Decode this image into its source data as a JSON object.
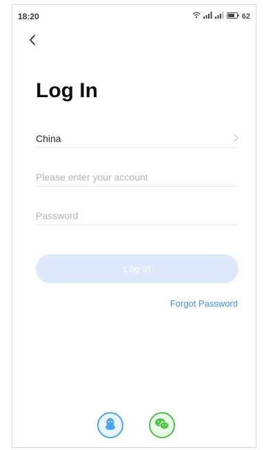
{
  "status_bar": {
    "time": "18:20",
    "battery": "62"
  },
  "page": {
    "title": "Log In"
  },
  "form": {
    "region_value": "China",
    "account_placeholder": "Please enter your account",
    "password_placeholder": "Password",
    "login_label": "Log In",
    "forgot_label": "Forgot Password"
  },
  "social": [
    {
      "icon": "qq-icon"
    },
    {
      "icon": "wechat-icon"
    }
  ],
  "colors": {
    "accent": "#3f8ef2",
    "button_disabled": "#dde9fa",
    "qq": "#4aa3f0",
    "wechat": "#4cc247"
  }
}
